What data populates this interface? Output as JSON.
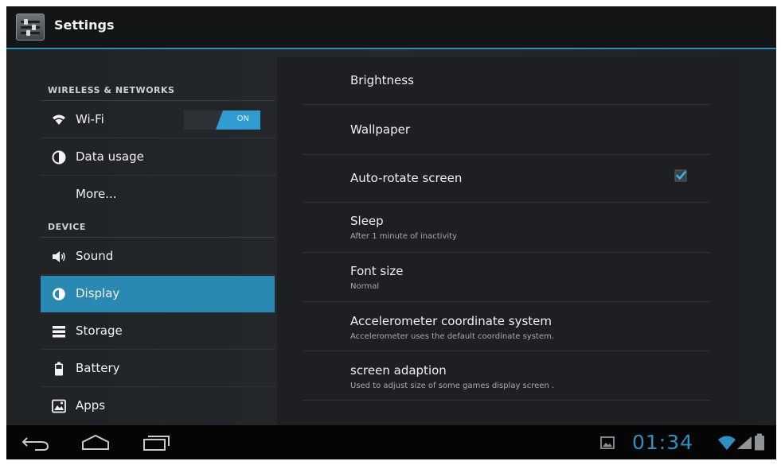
{
  "app": {
    "title": "Settings",
    "icon": "settings-sliders-icon"
  },
  "sidebar": {
    "headers": [
      "WIRELESS & NETWORKS",
      "DEVICE"
    ],
    "items": [
      {
        "label": "Wi-Fi",
        "icon": "wifi-icon",
        "toggle": "ON"
      },
      {
        "label": "Data usage",
        "icon": "data-usage-icon"
      },
      {
        "label": "More..."
      },
      {
        "label": "Sound",
        "icon": "sound-icon"
      },
      {
        "label": "Display",
        "icon": "display-icon",
        "selected": true
      },
      {
        "label": "Storage",
        "icon": "storage-icon"
      },
      {
        "label": "Battery",
        "icon": "battery-icon"
      },
      {
        "label": "Apps",
        "icon": "apps-icon"
      }
    ]
  },
  "display_settings": [
    {
      "title": "Brightness"
    },
    {
      "title": "Wallpaper"
    },
    {
      "title": "Auto-rotate screen",
      "checked": true
    },
    {
      "title": "Sleep",
      "summary": "After 1 minute of inactivity"
    },
    {
      "title": "Font size",
      "summary": "Normal"
    },
    {
      "title": "Accelerometer coordinate system",
      "summary": "Accelerometer uses the default coordinate system."
    },
    {
      "title": "screen adaption",
      "summary": "Used to adjust size of some games display screen ."
    }
  ],
  "navbar": {
    "buttons": [
      "back-icon",
      "home-icon",
      "recent-apps-icon"
    ]
  },
  "status": {
    "time": "01:34",
    "icons": [
      "screenshot-icon",
      "wifi-signal-icon",
      "cell-signal-icon",
      "battery-icon"
    ]
  },
  "colors": {
    "accent": "#2a89b3",
    "clock": "#2f8fc0",
    "background": "#1b1c1e"
  }
}
